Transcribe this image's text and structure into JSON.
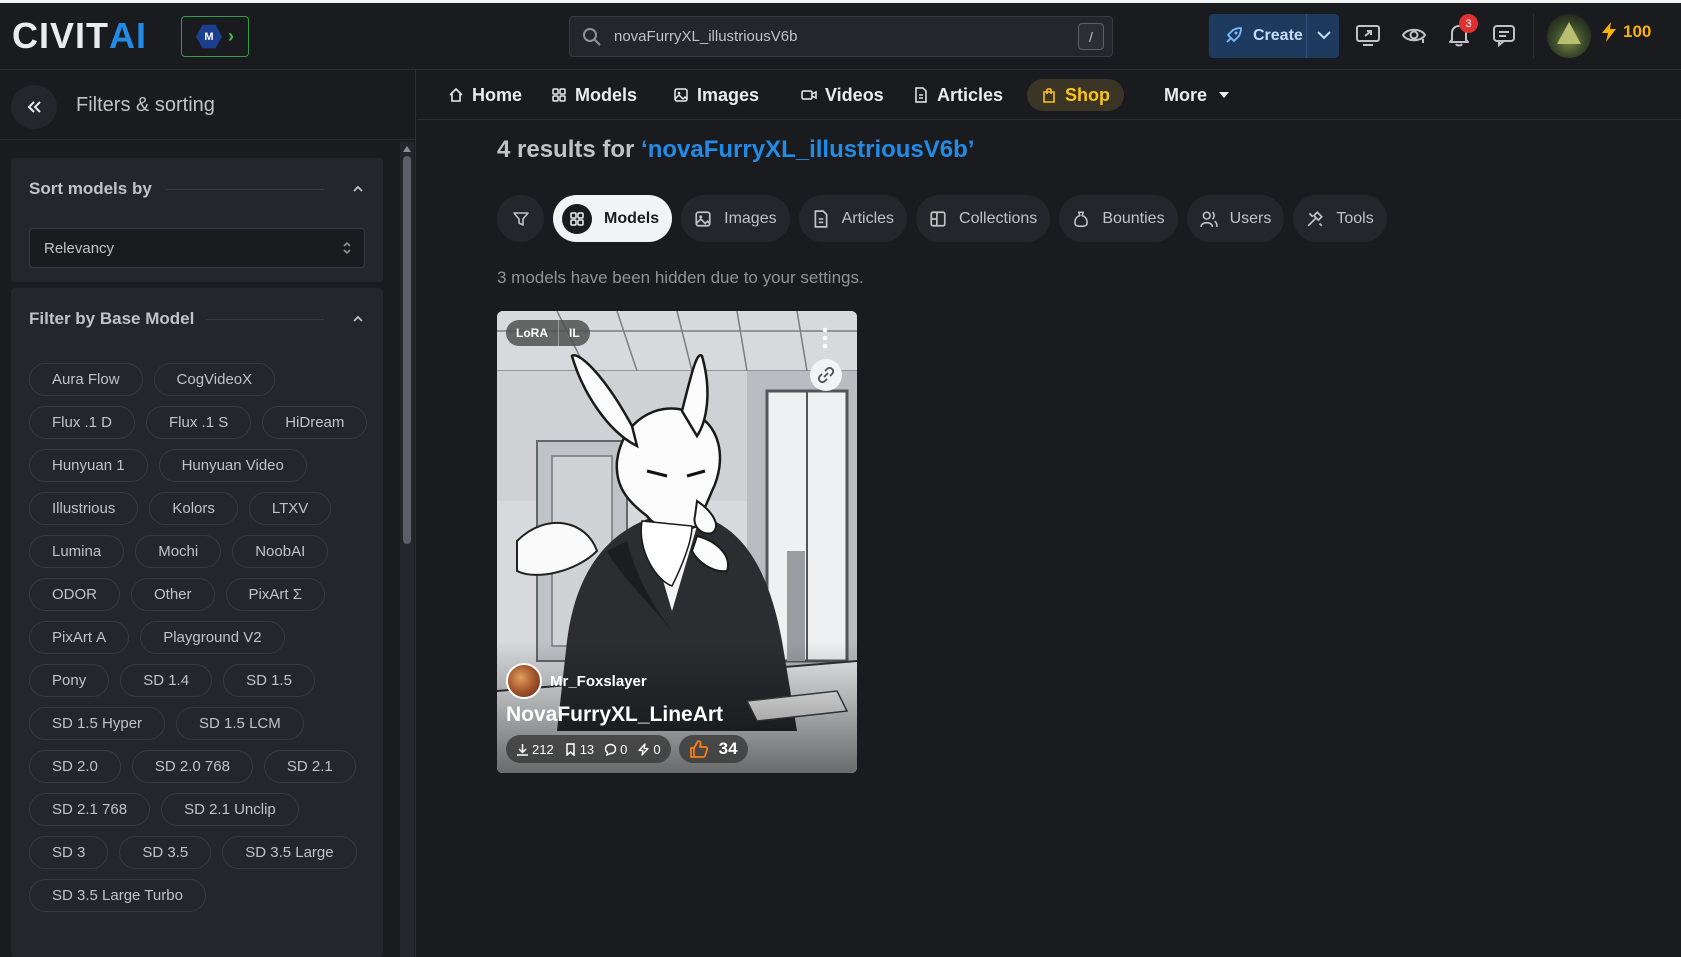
{
  "header": {
    "logo_text_a": "CIVIT",
    "logo_text_b": "AI",
    "search": {
      "value": "novaFurryXL_illustriousV6b",
      "shortcut": "/"
    },
    "create_label": "Create",
    "notifications_count": "3",
    "buzz_amount": "100"
  },
  "sidebar": {
    "title": "Filters & sorting",
    "sort": {
      "title": "Sort models by",
      "selected": "Relevancy"
    },
    "base_model": {
      "title": "Filter by Base Model",
      "chips": [
        "Aura Flow",
        "CogVideoX",
        "Flux .1 D",
        "Flux .1 S",
        "HiDream",
        "Hunyuan 1",
        "Hunyuan Video",
        "Illustrious",
        "Kolors",
        "LTXV",
        "Lumina",
        "Mochi",
        "NoobAI",
        "ODOR",
        "Other",
        "PixArt Σ",
        "PixArt Α",
        "Playground V2",
        "Pony",
        "SD 1.4",
        "SD 1.5",
        "SD 1.5 Hyper",
        "SD 1.5 LCM",
        "SD 2.0",
        "SD 2.0 768",
        "SD 2.1",
        "SD 2.1 768",
        "SD 2.1 Unclip",
        "SD 3",
        "SD 3.5",
        "SD 3.5 Large",
        "SD 3.5 Large Turbo"
      ]
    }
  },
  "nav": {
    "home": "Home",
    "models": "Models",
    "images": "Images",
    "videos": "Videos",
    "articles": "Articles",
    "shop": "Shop",
    "more": "More"
  },
  "main": {
    "results_prefix": "4 results for ",
    "results_query": "‘novaFurryXL_illustriousV6b’",
    "tabs": {
      "models": "Models",
      "images": "Images",
      "articles": "Articles",
      "collections": "Collections",
      "bounties": "Bounties",
      "users": "Users",
      "tools": "Tools"
    },
    "hidden_note": "3 models have been hidden due to your settings.",
    "card": {
      "type_tag": "LoRA",
      "base_tag": "IL",
      "creator": "Mr_Foxslayer",
      "title": "NovaFurryXL_LineArt",
      "downloads": "212",
      "bookmarks": "13",
      "comments": "0",
      "buzz": "0",
      "likes": "34"
    }
  }
}
